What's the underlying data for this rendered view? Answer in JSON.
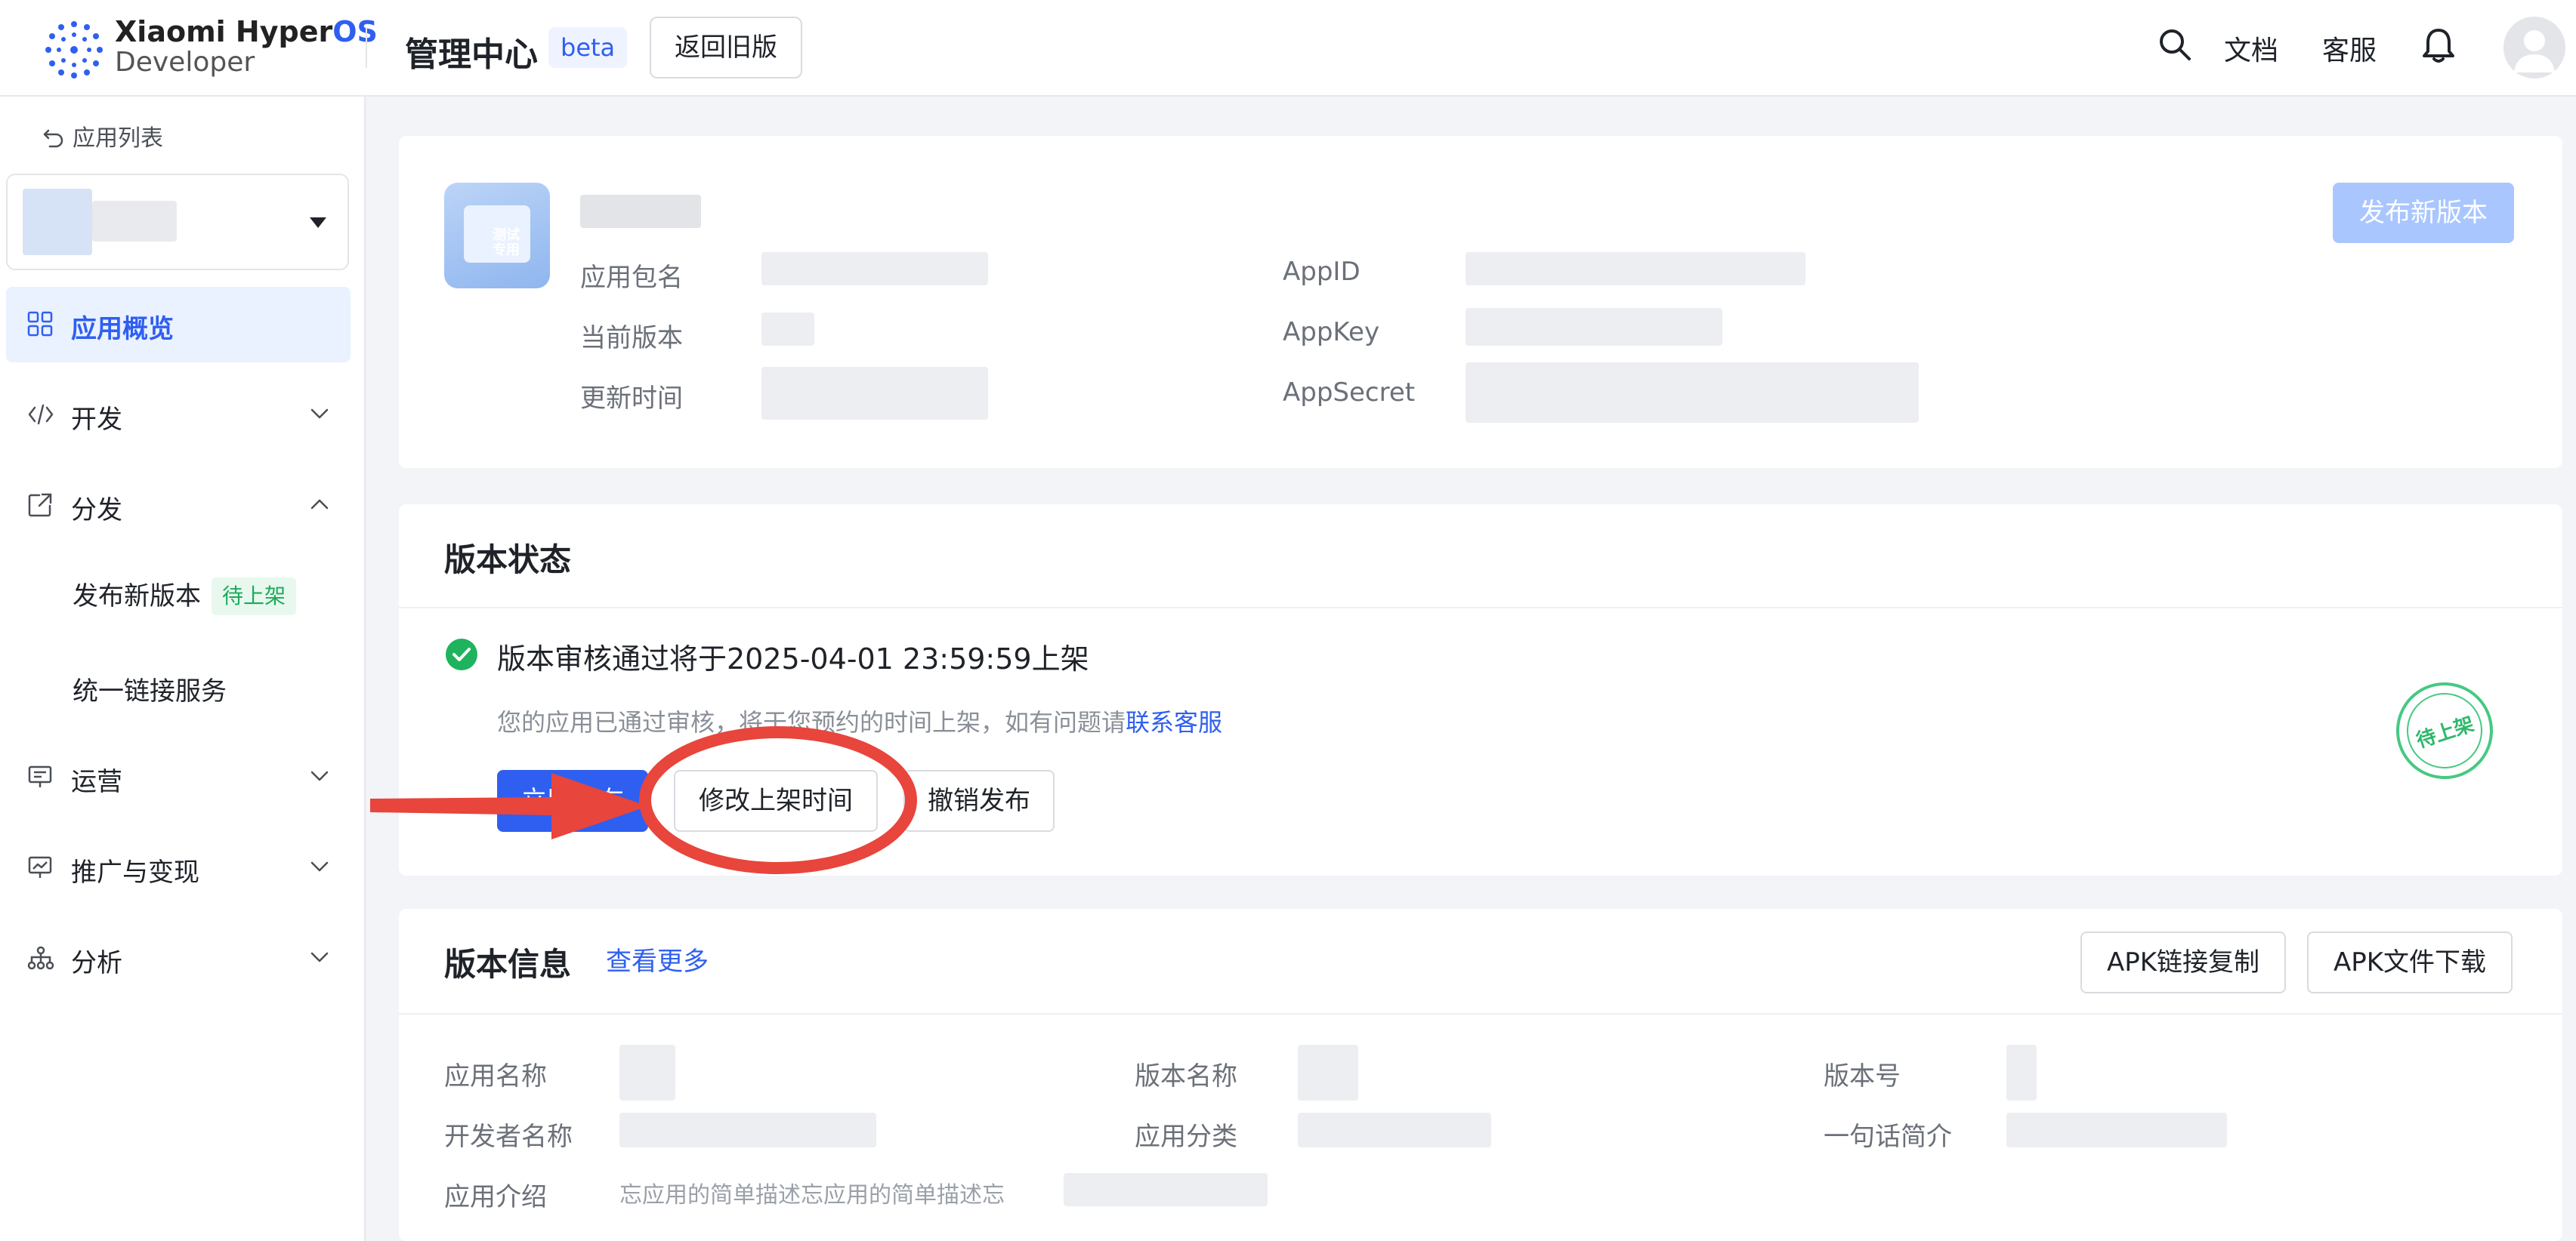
{
  "header": {
    "brand_line1": "Xiaomi Hyper",
    "brand_line1_os": "OS",
    "brand_line2": "Developer",
    "title": "管理中心",
    "beta": "beta",
    "back_old": "返回旧版",
    "docs": "文档",
    "support": "客服",
    "icons": [
      "search-icon",
      "bell-icon",
      "avatar"
    ]
  },
  "sidebar": {
    "back_label": "应用列表",
    "items": [
      {
        "label": "应用概览",
        "icon": "grid-icon",
        "active": true
      },
      {
        "label": "开发",
        "icon": "code-icon",
        "expanded": false
      },
      {
        "label": "分发",
        "icon": "share-icon",
        "expanded": true
      },
      {
        "label": "运营",
        "icon": "monitor-icon",
        "expanded": false
      },
      {
        "label": "推广与变现",
        "icon": "chart-monitor-icon",
        "expanded": false
      },
      {
        "label": "分析",
        "icon": "network-icon",
        "expanded": false
      }
    ],
    "sub_items": [
      {
        "label": "发布新版本",
        "badge": "待上架"
      },
      {
        "label": "统一链接服务"
      }
    ]
  },
  "overview": {
    "icon_tag_line1": "测试",
    "icon_tag_line2": "专用",
    "labels": {
      "package": "应用包名",
      "version": "当前版本",
      "updated": "更新时间",
      "appid": "AppID",
      "appkey": "AppKey",
      "appsecret": "AppSecret"
    },
    "publish_new": "发布新版本"
  },
  "status": {
    "title": "版本状态",
    "message": "版本审核通过将于2025-04-01 23:59:59上架",
    "desc": "您的应用已通过审核，将于您预约的时间上架，如有问题请",
    "contact": "联系客服",
    "btn_publish": "立即发布",
    "btn_modify": "修改上架时间",
    "btn_revoke": "撤销发布",
    "stamp": "待上架"
  },
  "version_info": {
    "title": "版本信息",
    "more": "查看更多",
    "btn_copy": "APK链接复制",
    "btn_download": "APK文件下载",
    "labels": {
      "app_name": "应用名称",
      "version_name": "版本名称",
      "version_code": "版本号",
      "developer": "开发者名称",
      "category": "应用分类",
      "brief": "一句话简介",
      "intro": "应用介绍"
    },
    "intro_fragment": "忘应用的简单描述忘应用的简单描述忘"
  },
  "colors": {
    "accent": "#2f5ff0",
    "success": "#1fb35e",
    "annotation": "#e8453c"
  }
}
